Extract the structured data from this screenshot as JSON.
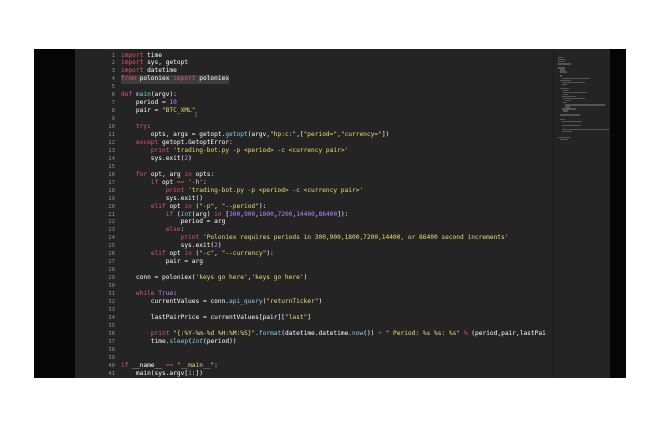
{
  "editor": {
    "line_numbers": [
      "1",
      "2",
      "3",
      "4",
      "5",
      "6",
      "7",
      "8",
      "9",
      "10",
      "11",
      "12",
      "13",
      "14",
      "15",
      "16",
      "17",
      "18",
      "19",
      "20",
      "21",
      "22",
      "23",
      "24",
      "25",
      "26",
      "27",
      "28",
      "29",
      "30",
      "31",
      "32",
      "33",
      "34",
      "35",
      "36",
      "37",
      "38",
      "39",
      "40",
      "41"
    ],
    "code_lines": [
      [
        [
          "kw",
          "import"
        ],
        [
          "nr",
          " time"
        ]
      ],
      [
        [
          "kw",
          "import"
        ],
        [
          "nr",
          " sys, getopt"
        ]
      ],
      [
        [
          "kw",
          "import"
        ],
        [
          "nr",
          " datetime"
        ]
      ],
      [
        [
          "kw",
          "from"
        ],
        [
          "nr",
          " poloniex "
        ],
        [
          "kw",
          "import"
        ],
        [
          "nr",
          " poloniex"
        ]
      ],
      [
        [
          "nr",
          ""
        ]
      ],
      [
        [
          "df",
          "def"
        ],
        [
          "nr",
          " "
        ],
        [
          "fn",
          "main"
        ],
        [
          "nr",
          "(argv):"
        ]
      ],
      [
        [
          "nr",
          "    period = "
        ],
        [
          "nm",
          "10"
        ]
      ],
      [
        [
          "nr",
          "    pair = "
        ],
        [
          "st",
          "\"BTC_XML\""
        ]
      ],
      [
        [
          "nr",
          ""
        ]
      ],
      [
        [
          "nr",
          "    "
        ],
        [
          "kw",
          "try"
        ],
        [
          "nr",
          ":"
        ]
      ],
      [
        [
          "nr",
          "        opts, args = getopt."
        ],
        [
          "fn",
          "getopt"
        ],
        [
          "nr",
          "(argv,"
        ],
        [
          "st",
          "\"hp:c:\""
        ],
        [
          "nr",
          ",["
        ],
        [
          "st",
          "\"period=\""
        ],
        [
          "nr",
          ","
        ],
        [
          "st",
          "\"currency=\""
        ],
        [
          "nr",
          "])"
        ]
      ],
      [
        [
          "nr",
          "    "
        ],
        [
          "kw",
          "except"
        ],
        [
          "nr",
          " getopt.GetoptError:"
        ]
      ],
      [
        [
          "nr",
          "        "
        ],
        [
          "kw",
          "print"
        ],
        [
          "nr",
          " "
        ],
        [
          "st",
          "'trading-bot.py -p <period> -c <currency pair>'"
        ]
      ],
      [
        [
          "nr",
          "        sys.exit("
        ],
        [
          "nm",
          "2"
        ],
        [
          "nr",
          ")"
        ]
      ],
      [
        [
          "nr",
          ""
        ]
      ],
      [
        [
          "nr",
          "    "
        ],
        [
          "kw",
          "for"
        ],
        [
          "nr",
          " opt, arg "
        ],
        [
          "kw",
          "in"
        ],
        [
          "nr",
          " opts:"
        ]
      ],
      [
        [
          "nr",
          "        "
        ],
        [
          "kw",
          "if"
        ],
        [
          "nr",
          " opt "
        ],
        [
          "kw",
          "=="
        ],
        [
          "nr",
          " "
        ],
        [
          "st",
          "'-h'"
        ],
        [
          "nr",
          ":"
        ]
      ],
      [
        [
          "nr",
          "            "
        ],
        [
          "kw",
          "print"
        ],
        [
          "nr",
          " "
        ],
        [
          "st",
          "'trading-bot.py -p <period> -c <currency pair>'"
        ]
      ],
      [
        [
          "nr",
          "            sys.exit()"
        ]
      ],
      [
        [
          "nr",
          "        "
        ],
        [
          "kw",
          "elif"
        ],
        [
          "nr",
          " opt "
        ],
        [
          "kw",
          "in"
        ],
        [
          "nr",
          " ("
        ],
        [
          "st",
          "\"-p\""
        ],
        [
          "nr",
          ", "
        ],
        [
          "st",
          "\"--period\""
        ],
        [
          "nr",
          "):"
        ]
      ],
      [
        [
          "nr",
          "            "
        ],
        [
          "kw",
          "if"
        ],
        [
          "nr",
          " ("
        ],
        [
          "bi",
          "int"
        ],
        [
          "nr",
          "(arg) "
        ],
        [
          "kw",
          "in"
        ],
        [
          "nr",
          " ["
        ],
        [
          "nm",
          "300"
        ],
        [
          "nr",
          ","
        ],
        [
          "nm",
          "900"
        ],
        [
          "nr",
          ","
        ],
        [
          "nm",
          "1800"
        ],
        [
          "nr",
          ","
        ],
        [
          "nm",
          "7200"
        ],
        [
          "nr",
          ","
        ],
        [
          "nm",
          "14400"
        ],
        [
          "nr",
          ","
        ],
        [
          "nm",
          "86400"
        ],
        [
          "nr",
          "]):"
        ]
      ],
      [
        [
          "nr",
          "                period = arg"
        ]
      ],
      [
        [
          "nr",
          "            "
        ],
        [
          "kw",
          "else"
        ],
        [
          "nr",
          ":"
        ]
      ],
      [
        [
          "nr",
          "                "
        ],
        [
          "kw",
          "print"
        ],
        [
          "nr",
          " "
        ],
        [
          "st",
          "'Poloniex requires periods in 300,900,1800,7200,14400, or 86400 second increments'"
        ]
      ],
      [
        [
          "nr",
          "                sys.exit("
        ],
        [
          "nm",
          "2"
        ],
        [
          "nr",
          ")"
        ]
      ],
      [
        [
          "nr",
          "        "
        ],
        [
          "kw",
          "elif"
        ],
        [
          "nr",
          " opt "
        ],
        [
          "kw",
          "in"
        ],
        [
          "nr",
          " ("
        ],
        [
          "st",
          "\"-c\""
        ],
        [
          "nr",
          ", "
        ],
        [
          "st",
          "\"--currency\""
        ],
        [
          "nr",
          "):"
        ]
      ],
      [
        [
          "nr",
          "            pair = arg"
        ]
      ],
      [
        [
          "nr",
          ""
        ]
      ],
      [
        [
          "nr",
          "    conn = poloniex("
        ],
        [
          "st",
          "'keys go here'"
        ],
        [
          "nr",
          ","
        ],
        [
          "st",
          "'keys go here'"
        ],
        [
          "nr",
          ")"
        ]
      ],
      [
        [
          "nr",
          ""
        ]
      ],
      [
        [
          "nr",
          "    "
        ],
        [
          "kw",
          "while"
        ],
        [
          "nr",
          " "
        ],
        [
          "nm",
          "True"
        ],
        [
          "nr",
          ":"
        ]
      ],
      [
        [
          "nr",
          "        currentValues = conn."
        ],
        [
          "fn",
          "api_query"
        ],
        [
          "nr",
          "("
        ],
        [
          "st",
          "\"returnTicker\""
        ],
        [
          "nr",
          ")"
        ]
      ],
      [
        [
          "nr",
          ""
        ]
      ],
      [
        [
          "nr",
          "        lastPairPrice = currentValues[pair]["
        ],
        [
          "st",
          "\"last\""
        ],
        [
          "nr",
          "]"
        ]
      ],
      [
        [
          "nr",
          ""
        ]
      ],
      [
        [
          "nr",
          "        "
        ],
        [
          "kw",
          "print"
        ],
        [
          "nr",
          " "
        ],
        [
          "st",
          "\"{:%Y-%m-%d %H:%M:%S}\""
        ],
        [
          "nr",
          "."
        ],
        [
          "fn",
          "format"
        ],
        [
          "nr",
          "(datetime.datetime."
        ],
        [
          "fn",
          "now"
        ],
        [
          "nr",
          "()) "
        ],
        [
          "kw",
          "+"
        ],
        [
          "nr",
          " "
        ],
        [
          "st",
          "\" Period: %s %s: %s\""
        ],
        [
          "nr",
          " "
        ],
        [
          "kw",
          "%"
        ],
        [
          "nr",
          " (period,pair,lastPai"
        ]
      ],
      [
        [
          "nr",
          "        time."
        ],
        [
          "fn",
          "sleep"
        ],
        [
          "nr",
          "("
        ],
        [
          "bi",
          "int"
        ],
        [
          "nr",
          "(period))"
        ]
      ],
      [
        [
          "nr",
          ""
        ]
      ],
      [
        [
          "nr",
          ""
        ]
      ],
      [
        [
          "kw",
          "if"
        ],
        [
          "nr",
          " __name__ "
        ],
        [
          "kw",
          "=="
        ],
        [
          "nr",
          " "
        ],
        [
          "st",
          "\"__main__\""
        ],
        [
          "nr",
          ":"
        ]
      ],
      [
        [
          "nr",
          "    main(sys.argv["
        ],
        [
          "nm",
          "1"
        ],
        [
          "nr",
          ":])"
        ]
      ]
    ]
  },
  "colors": {
    "background": "#242424",
    "keyword": "#e0527a",
    "string": "#e9dd76",
    "number": "#b388ff",
    "function": "#7ccff2",
    "text": "#e6e6e6"
  },
  "icons": {
    "cursor": "i-beam-cursor-icon"
  }
}
